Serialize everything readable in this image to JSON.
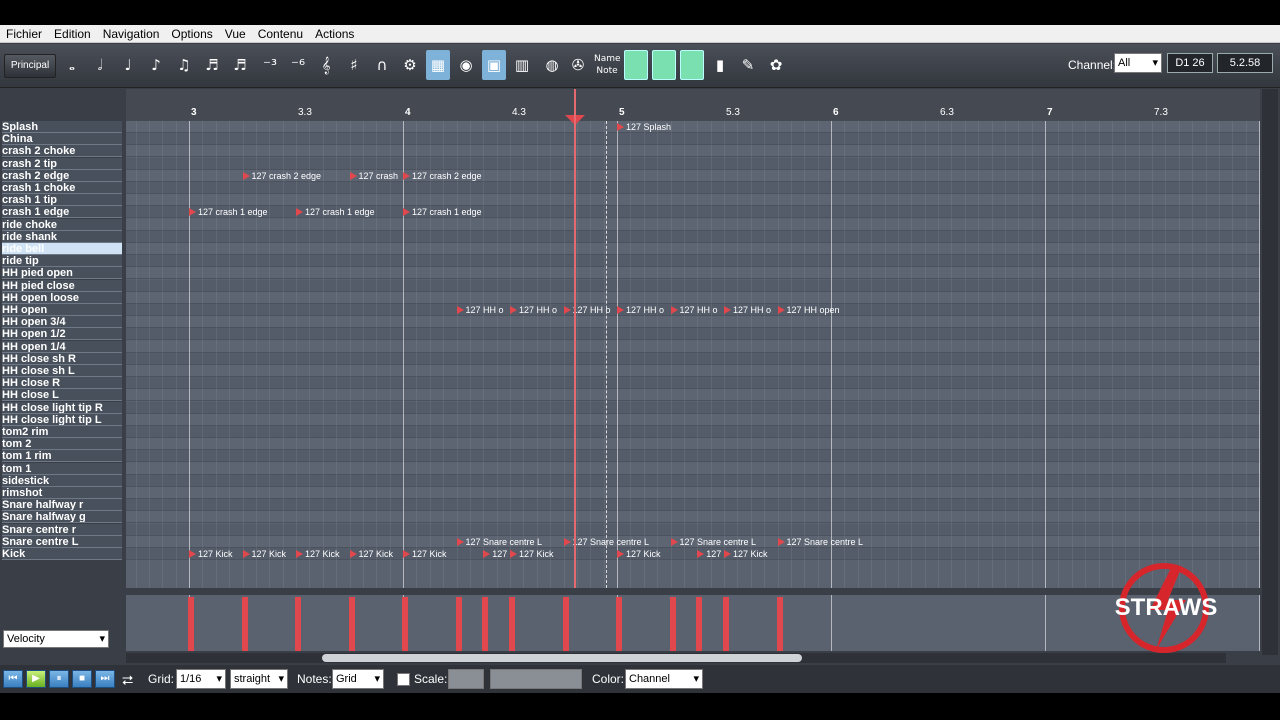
{
  "menu": [
    "Fichier",
    "Edition",
    "Navigation",
    "Options",
    "Vue",
    "Contenu",
    "Actions"
  ],
  "toolbar": {
    "principal": "Principal",
    "name_note_top": "Name",
    "name_note_bottom": "Note",
    "channel_label": "Channel:",
    "channel_value": "All",
    "readout_1": "D1 26",
    "readout_2": "5.2.58"
  },
  "ruler": [
    {
      "label": "3",
      "major": true,
      "bar": 3.0
    },
    {
      "label": "3.3",
      "major": false,
      "bar": 3.5
    },
    {
      "label": "4",
      "major": true,
      "bar": 4.0
    },
    {
      "label": "4.3",
      "major": false,
      "bar": 4.5
    },
    {
      "label": "5",
      "major": true,
      "bar": 5.0
    },
    {
      "label": "5.3",
      "major": false,
      "bar": 5.5
    },
    {
      "label": "6",
      "major": true,
      "bar": 6.0
    },
    {
      "label": "6.3",
      "major": false,
      "bar": 6.5
    },
    {
      "label": "7",
      "major": true,
      "bar": 7.0
    },
    {
      "label": "7.3",
      "major": false,
      "bar": 7.5
    }
  ],
  "pieces": [
    "Splash",
    "China",
    "crash 2 choke",
    "crash 2 tip",
    "crash 2 edge",
    "crash 1 choke",
    "crash 1 tip",
    "crash 1 edge",
    "ride choke",
    "ride shank",
    "ride bell",
    "ride tip",
    "HH pied open",
    "HH pied close",
    "HH open loose",
    "HH open",
    "HH open 3/4",
    "HH open 1/2",
    "HH open 1/4",
    "HH close sh R",
    "HH close sh L",
    "HH close R",
    "HH close L",
    "HH close light tip R",
    "HH close light tip L",
    "tom2 rim",
    "tom 2",
    "tom 1 rim",
    "tom 1",
    "sidestick",
    "rimshot",
    "Snare halfway r",
    "Snare halfway g",
    "Snare centre r",
    "Snare centre L",
    "Kick"
  ],
  "selected_piece": "ride bell",
  "notes": [
    {
      "row": 0,
      "beat": 5.0,
      "text": "127 Splash"
    },
    {
      "row": 4,
      "beat": 3.25,
      "text": "127 crash 2 edge"
    },
    {
      "row": 4,
      "beat": 3.75,
      "text": "127 crash"
    },
    {
      "row": 4,
      "beat": 4.0,
      "text": "127 crash 2 edge"
    },
    {
      "row": 7,
      "beat": 3.0,
      "text": "127 crash 1 edge"
    },
    {
      "row": 7,
      "beat": 3.5,
      "text": "127 crash 1 edge"
    },
    {
      "row": 7,
      "beat": 4.0,
      "text": "127 crash 1 edge"
    },
    {
      "row": 15,
      "beat": 4.25,
      "text": "127 HH o"
    },
    {
      "row": 15,
      "beat": 4.5,
      "text": "127 HH o"
    },
    {
      "row": 15,
      "beat": 4.75,
      "text": "127 HH o"
    },
    {
      "row": 15,
      "beat": 5.0,
      "text": "127 HH o"
    },
    {
      "row": 15,
      "beat": 5.25,
      "text": "127 HH o"
    },
    {
      "row": 15,
      "beat": 5.5,
      "text": "127 HH o"
    },
    {
      "row": 15,
      "beat": 5.75,
      "text": "127 HH open"
    },
    {
      "row": 34,
      "beat": 4.25,
      "text": "127 Snare centre L"
    },
    {
      "row": 34,
      "beat": 4.75,
      "text": "127 Snare centre L"
    },
    {
      "row": 34,
      "beat": 5.25,
      "text": "127 Snare centre L"
    },
    {
      "row": 34,
      "beat": 5.75,
      "text": "127 Snare centre L"
    },
    {
      "row": 35,
      "beat": 3.0,
      "text": "127 Kick"
    },
    {
      "row": 35,
      "beat": 3.25,
      "text": "127 Kick"
    },
    {
      "row": 35,
      "beat": 3.5,
      "text": "127 Kick"
    },
    {
      "row": 35,
      "beat": 3.75,
      "text": "127 Kick"
    },
    {
      "row": 35,
      "beat": 4.0,
      "text": "127 Kick"
    },
    {
      "row": 35,
      "beat": 4.375,
      "text": "127"
    },
    {
      "row": 35,
      "beat": 4.5,
      "text": "127 Kick"
    },
    {
      "row": 35,
      "beat": 5.0,
      "text": "127 Kick"
    },
    {
      "row": 35,
      "beat": 5.375,
      "text": "127"
    },
    {
      "row": 35,
      "beat": 5.5,
      "text": "127 Kick"
    }
  ],
  "velocity_bars": [
    3.0,
    3.25,
    3.5,
    3.75,
    4.0,
    4.25,
    4.375,
    4.5,
    4.75,
    5.0,
    5.25,
    5.375,
    5.5,
    5.75
  ],
  "bottom": {
    "grid_label": "Grid:",
    "grid_value": "1/16",
    "feel_value": "straight",
    "notes_label": "Notes:",
    "notes_value": "Grid",
    "scale_label": "Scale:",
    "color_label": "Color:",
    "color_value": "Channel",
    "velocity_value": "Velocity"
  },
  "logo_text": "STRAWS",
  "colors": {
    "note": "#e0484d",
    "playhead": "#e56a70",
    "grid_bg": "#5a6270",
    "accent": "#7be0b0"
  }
}
